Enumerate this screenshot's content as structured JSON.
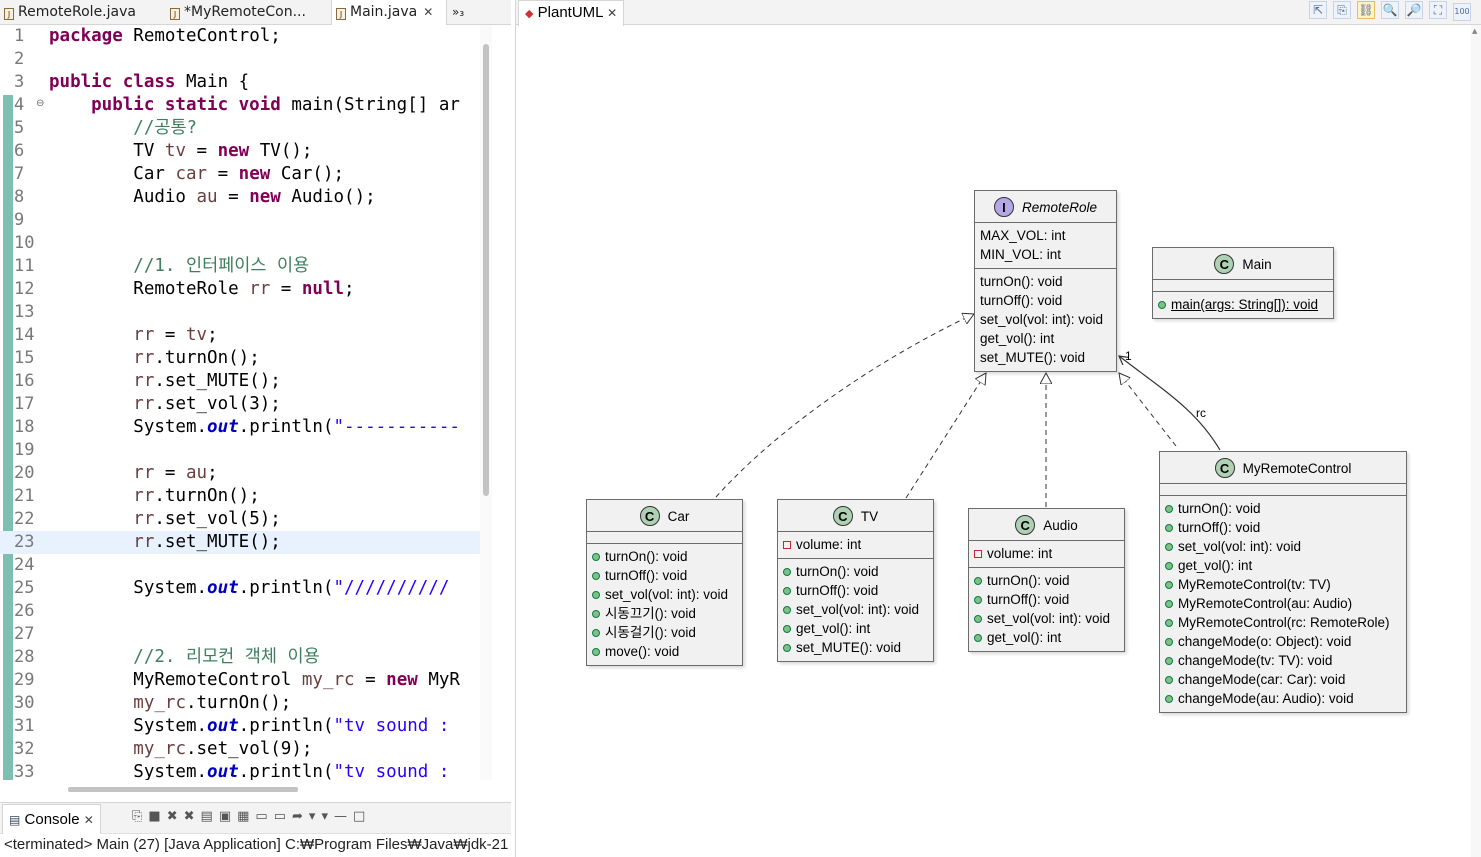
{
  "editor": {
    "tabs": [
      {
        "label": "RemoteRole.java",
        "active": false
      },
      {
        "label": "*MyRemoteCon...",
        "active": false
      },
      {
        "label": "Main.java",
        "active": true
      }
    ],
    "overflow_label": "»₃",
    "lines": [
      {
        "n": "1",
        "tokens": [
          {
            "t": "package ",
            "c": "kw"
          },
          {
            "t": "RemoteControl;",
            "c": ""
          }
        ]
      },
      {
        "n": "2",
        "tokens": []
      },
      {
        "n": "3",
        "tokens": [
          {
            "t": "public class ",
            "c": "kw"
          },
          {
            "t": "Main {",
            "c": ""
          }
        ]
      },
      {
        "n": "4",
        "fold": true,
        "tokens": [
          {
            "t": "    public static void ",
            "c": "kw"
          },
          {
            "t": "main(String[] ar",
            "c": ""
          }
        ]
      },
      {
        "n": "5",
        "tokens": [
          {
            "t": "        //공통?",
            "c": "cm"
          }
        ]
      },
      {
        "n": "6",
        "tokens": [
          {
            "t": "        TV ",
            "c": ""
          },
          {
            "t": "tv",
            "c": "va"
          },
          {
            "t": " = ",
            "c": ""
          },
          {
            "t": "new ",
            "c": "kw"
          },
          {
            "t": "TV();",
            "c": ""
          }
        ]
      },
      {
        "n": "7",
        "tokens": [
          {
            "t": "        Car ",
            "c": ""
          },
          {
            "t": "car",
            "c": "va"
          },
          {
            "t": " = ",
            "c": ""
          },
          {
            "t": "new ",
            "c": "kw"
          },
          {
            "t": "Car();",
            "c": ""
          }
        ]
      },
      {
        "n": "8",
        "tokens": [
          {
            "t": "        Audio ",
            "c": ""
          },
          {
            "t": "au",
            "c": "va"
          },
          {
            "t": " = ",
            "c": ""
          },
          {
            "t": "new ",
            "c": "kw"
          },
          {
            "t": "Audio();",
            "c": ""
          }
        ]
      },
      {
        "n": "9",
        "tokens": []
      },
      {
        "n": "10",
        "tokens": []
      },
      {
        "n": "11",
        "tokens": [
          {
            "t": "        //1. 인터페이스 이용",
            "c": "cm"
          }
        ]
      },
      {
        "n": "12",
        "tokens": [
          {
            "t": "        RemoteRole ",
            "c": ""
          },
          {
            "t": "rr",
            "c": "va"
          },
          {
            "t": " = ",
            "c": ""
          },
          {
            "t": "null",
            "c": "kw"
          },
          {
            "t": ";",
            "c": ""
          }
        ]
      },
      {
        "n": "13",
        "tokens": []
      },
      {
        "n": "14",
        "tokens": [
          {
            "t": "        ",
            "c": ""
          },
          {
            "t": "rr",
            "c": "va"
          },
          {
            "t": " = ",
            "c": ""
          },
          {
            "t": "tv",
            "c": "va"
          },
          {
            "t": ";",
            "c": ""
          }
        ]
      },
      {
        "n": "15",
        "tokens": [
          {
            "t": "        ",
            "c": ""
          },
          {
            "t": "rr",
            "c": "va"
          },
          {
            "t": ".turnOn();",
            "c": ""
          }
        ]
      },
      {
        "n": "16",
        "tokens": [
          {
            "t": "        ",
            "c": ""
          },
          {
            "t": "rr",
            "c": "va"
          },
          {
            "t": ".set_MUTE();",
            "c": ""
          }
        ]
      },
      {
        "n": "17",
        "tokens": [
          {
            "t": "        ",
            "c": ""
          },
          {
            "t": "rr",
            "c": "va"
          },
          {
            "t": ".set_vol(3);",
            "c": ""
          }
        ]
      },
      {
        "n": "18",
        "tokens": [
          {
            "t": "        System.",
            "c": ""
          },
          {
            "t": "out",
            "c": "fd"
          },
          {
            "t": ".println(",
            "c": ""
          },
          {
            "t": "\"-----------",
            "c": "st"
          }
        ]
      },
      {
        "n": "19",
        "tokens": []
      },
      {
        "n": "20",
        "tokens": [
          {
            "t": "        ",
            "c": ""
          },
          {
            "t": "rr",
            "c": "va"
          },
          {
            "t": " = ",
            "c": ""
          },
          {
            "t": "au",
            "c": "va"
          },
          {
            "t": ";",
            "c": ""
          }
        ]
      },
      {
        "n": "21",
        "tokens": [
          {
            "t": "        ",
            "c": ""
          },
          {
            "t": "rr",
            "c": "va"
          },
          {
            "t": ".turnOn();",
            "c": ""
          }
        ]
      },
      {
        "n": "22",
        "tokens": [
          {
            "t": "        ",
            "c": ""
          },
          {
            "t": "rr",
            "c": "va"
          },
          {
            "t": ".set_vol(5);",
            "c": ""
          }
        ]
      },
      {
        "n": "23",
        "hl": true,
        "tokens": [
          {
            "t": "        ",
            "c": ""
          },
          {
            "t": "rr",
            "c": "va"
          },
          {
            "t": ".set_MUTE();",
            "c": ""
          }
        ]
      },
      {
        "n": "24",
        "tokens": []
      },
      {
        "n": "25",
        "tokens": [
          {
            "t": "        System.",
            "c": ""
          },
          {
            "t": "out",
            "c": "fd"
          },
          {
            "t": ".println(",
            "c": ""
          },
          {
            "t": "\"//////////",
            "c": "st"
          }
        ]
      },
      {
        "n": "26",
        "tokens": []
      },
      {
        "n": "27",
        "tokens": []
      },
      {
        "n": "28",
        "tokens": [
          {
            "t": "        //2. 리모컨 객체 이용",
            "c": "cm"
          }
        ]
      },
      {
        "n": "29",
        "tokens": [
          {
            "t": "        MyRemoteControl ",
            "c": ""
          },
          {
            "t": "my_rc",
            "c": "va"
          },
          {
            "t": " = ",
            "c": ""
          },
          {
            "t": "new ",
            "c": "kw"
          },
          {
            "t": "MyR",
            "c": ""
          }
        ]
      },
      {
        "n": "30",
        "tokens": [
          {
            "t": "        ",
            "c": ""
          },
          {
            "t": "my_rc",
            "c": "va"
          },
          {
            "t": ".turnOn();",
            "c": ""
          }
        ]
      },
      {
        "n": "31",
        "tokens": [
          {
            "t": "        System.",
            "c": ""
          },
          {
            "t": "out",
            "c": "fd"
          },
          {
            "t": ".println(",
            "c": ""
          },
          {
            "t": "\"tv sound : ",
            "c": "st"
          }
        ]
      },
      {
        "n": "32",
        "tokens": [
          {
            "t": "        ",
            "c": ""
          },
          {
            "t": "my_rc",
            "c": "va"
          },
          {
            "t": ".set_vol(9);",
            "c": ""
          }
        ]
      },
      {
        "n": "33",
        "tokens": [
          {
            "t": "        System.",
            "c": ""
          },
          {
            "t": "out",
            "c": "fd"
          },
          {
            "t": ".println(",
            "c": ""
          },
          {
            "t": "\"tv sound : ",
            "c": "st"
          }
        ]
      }
    ]
  },
  "console": {
    "tab_label": "Console",
    "icons": [
      "pin-icon",
      "stop-icon",
      "remove-launch-icon",
      "remove-all-icon",
      "clear-console-icon",
      "scroll-lock-icon",
      "word-wrap-icon",
      "show-stdout-icon",
      "show-stderr-icon",
      "pin-console-icon",
      "display-console-icon",
      "new-console-icon",
      "minimize-icon",
      "maximize-icon"
    ],
    "status": "<terminated> Main (27) [Java Application] C:₩Program Files₩Java₩jdk-21"
  },
  "uml": {
    "tab_label": "PlantUML",
    "toolbar_icons": [
      "export-icon",
      "copy-icon",
      "link-icon",
      "zoom-in-icon",
      "zoom-out-icon",
      "fit-icon",
      "zoom-100-icon"
    ],
    "toolbar_glyphs": [
      "⇱",
      "⎘",
      "⛓",
      "🔍",
      "🔎",
      "⛶",
      "100"
    ],
    "classes": {
      "remoterole": {
        "badge": "I",
        "name": "RemoteRole",
        "fields": [
          "MAX_VOL: int",
          "MIN_VOL: int"
        ],
        "methods": [
          "turnOn(): void",
          "turnOff(): void",
          "set_vol(vol: int): void",
          "get_vol(): int",
          "set_MUTE(): void"
        ]
      },
      "main": {
        "badge": "C",
        "name": "Main",
        "methods": [
          "main(args: String[]): void"
        ]
      },
      "car": {
        "badge": "C",
        "name": "Car",
        "methods": [
          "turnOn(): void",
          "turnOff(): void",
          "set_vol(vol: int): void",
          "시동끄기(): void",
          "시동걸기(): void",
          "move(): void"
        ]
      },
      "tv": {
        "badge": "C",
        "name": "TV",
        "fields": [
          "volume: int"
        ],
        "methods": [
          "turnOn(): void",
          "turnOff(): void",
          "set_vol(vol: int): void",
          "get_vol(): int",
          "set_MUTE(): void"
        ]
      },
      "audio": {
        "badge": "C",
        "name": "Audio",
        "fields": [
          "volume: int"
        ],
        "methods": [
          "turnOn(): void",
          "turnOff(): void",
          "set_vol(vol: int): void",
          "get_vol(): int"
        ]
      },
      "myremotecontrol": {
        "badge": "C",
        "name": "MyRemoteControl",
        "methods": [
          "turnOn(): void",
          "turnOff(): void",
          "set_vol(vol: int): void",
          "get_vol(): int",
          "MyRemoteControl(tv: TV)",
          "MyRemoteControl(au: Audio)",
          "MyRemoteControl(rc: RemoteRole)",
          "changeMode(o: Object): void",
          "changeMode(tv: TV): void",
          "changeMode(car: Car): void",
          "changeMode(au: Audio): void"
        ]
      }
    },
    "assoc_label": "rc",
    "assoc_multiplicity": "1"
  },
  "colors": {
    "keyword": "#7f0055",
    "comment": "#3f7f5f",
    "string": "#2a00ff",
    "field": "#0000c0",
    "local_var": "#6a3e3e",
    "class_badge": "#add1b2",
    "interface_badge": "#b4a7e5",
    "quick_diff": "#7dbfb0"
  }
}
